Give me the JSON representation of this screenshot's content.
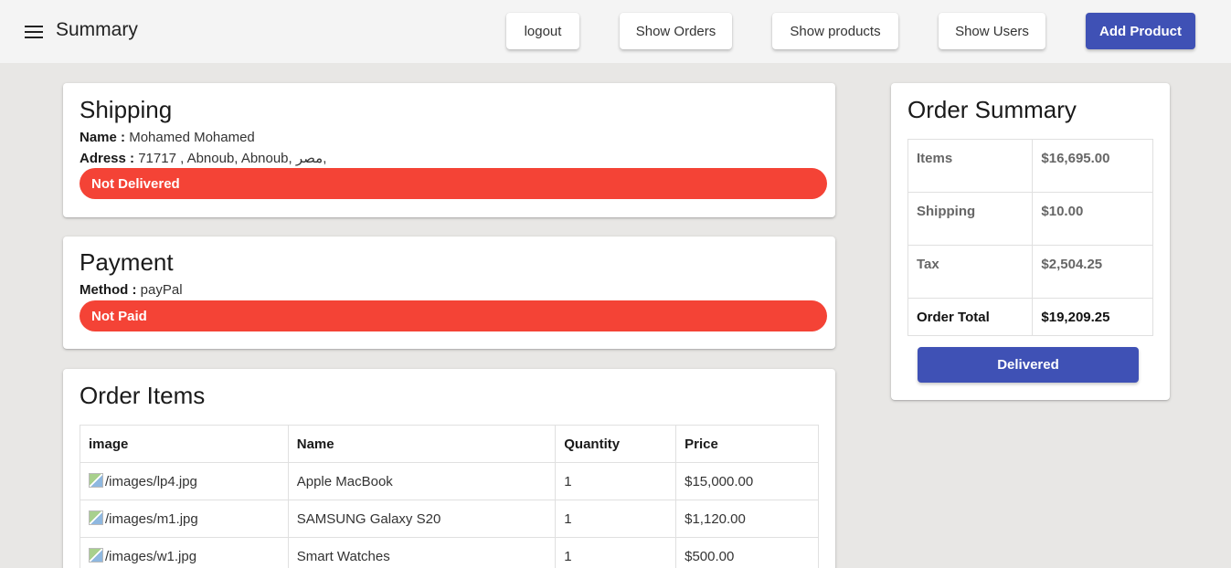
{
  "appbar": {
    "title": "Summary",
    "menu_icon": "hamburger-menu-icon",
    "buttons": {
      "logout": "logout",
      "show_orders": "Show Orders",
      "show_products": "Show products",
      "show_users": "Show Users",
      "add_product": "Add Product"
    }
  },
  "colors": {
    "primary": "#3f51b5",
    "danger": "#f44336",
    "background": "#e8e7e5"
  },
  "shipping": {
    "title": "Shipping",
    "name_label": "Name :",
    "name_value": "Mohamed Mohamed",
    "address_label": "Adress :",
    "address_value": "71717 , Abnoub, Abnoub, مصر,",
    "status": "Not Delivered"
  },
  "payment": {
    "title": "Payment",
    "method_label": "Method :",
    "method_value": "payPal",
    "status": "Not Paid"
  },
  "order_items": {
    "title": "Order Items",
    "columns": [
      "image",
      "Name",
      "Quantity",
      "Price"
    ],
    "rows": [
      {
        "image": "/images/lp4.jpg",
        "name": "Apple MacBook",
        "quantity": "1",
        "price": "$15,000.00"
      },
      {
        "image": "/images/m1.jpg",
        "name": "SAMSUNG Galaxy S20",
        "quantity": "1",
        "price": "$1,120.00"
      },
      {
        "image": "/images/w1.jpg",
        "name": "Smart Watches",
        "quantity": "1",
        "price": "$500.00"
      }
    ]
  },
  "order_summary": {
    "title": "Order Summary",
    "rows": [
      {
        "label": "Items",
        "value": "$16,695.00"
      },
      {
        "label": "Shipping",
        "value": "$10.00"
      },
      {
        "label": "Tax",
        "value": "$2,504.25"
      },
      {
        "label": "Order Total",
        "value": "$19,209.25"
      }
    ],
    "delivered_button": "Delivered"
  }
}
